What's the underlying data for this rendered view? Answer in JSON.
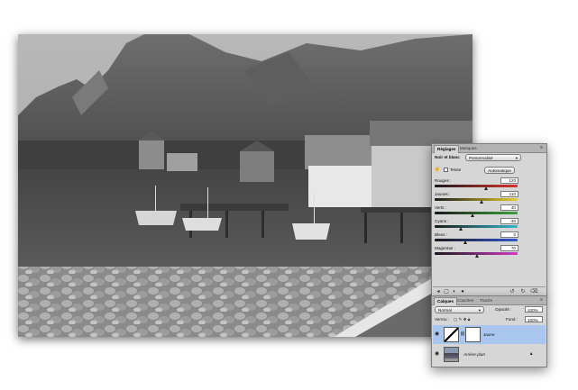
{
  "adjustments_panel": {
    "tabs": [
      "Réglages",
      "Masques"
    ],
    "title": "Noir et blanc",
    "preset": "Personnalisé",
    "tint_label": "Teinte",
    "auto_label": "Automatique",
    "sliders": [
      {
        "label": "Rouges :",
        "value": "120",
        "fraction": 0.62,
        "color": "#d8342e"
      },
      {
        "label": "Jaunes :",
        "value": "110",
        "fraction": 0.57,
        "color": "#e6cf2e"
      },
      {
        "label": "Verts :",
        "value": "40",
        "fraction": 0.46,
        "color": "#3da03a"
      },
      {
        "label": "Cyans :",
        "value": "-30",
        "fraction": 0.32,
        "color": "#37b6c8"
      },
      {
        "label": "Bleus :",
        "value": "0",
        "fraction": 0.37,
        "color": "#2e56d1"
      },
      {
        "label": "Magentas :",
        "value": "70",
        "fraction": 0.52,
        "color": "#d23ac8"
      }
    ]
  },
  "layers_panel": {
    "tabs": [
      "Calques",
      "Couches",
      "Tracés"
    ],
    "blend_mode": "Normal",
    "opacity_label": "Opacité :",
    "opacity_value": "100%",
    "lock_label": "Verrou :",
    "fill_label": "Fond :",
    "fill_value": "100%",
    "layers": [
      {
        "name": "Jaune",
        "selected": true
      },
      {
        "name": "Arrière-plan",
        "selected": false
      }
    ]
  },
  "icons": [
    "close-icon",
    "mode-icon",
    "eye-icon",
    "lock-icon",
    "chain-icon",
    "link-icon",
    "fx-icon",
    "mask-icon",
    "new-layer-icon",
    "trash-icon"
  ]
}
